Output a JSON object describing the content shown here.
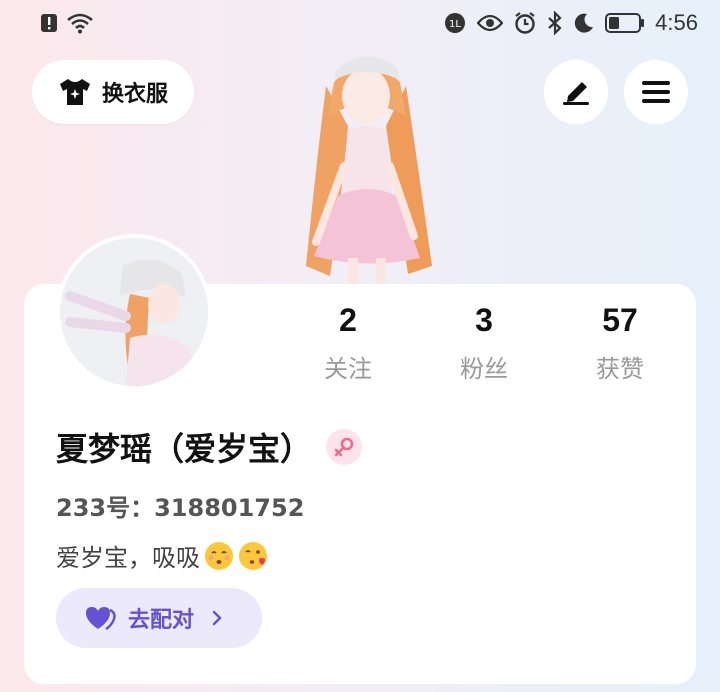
{
  "status_bar": {
    "time": "4:56",
    "left_icons": [
      "alert-icon",
      "wifi-icon"
    ],
    "right_icons": [
      "hd-icon",
      "eye-icon",
      "alarm-icon",
      "bluetooth-icon",
      "moon-icon",
      "battery-icon"
    ]
  },
  "top_actions": {
    "outfit_label": "换衣服",
    "edit_icon": "pen-icon",
    "menu_icon": "menu-icon"
  },
  "profile": {
    "name": "夏梦瑶（爱岁宝）",
    "gender": "female",
    "id_line": "233号：318801752",
    "bio": "爱岁宝，吸吸",
    "bio_emojis": [
      "kissing-emoji",
      "kissing-heart-emoji"
    ]
  },
  "stats": [
    {
      "value": "2",
      "label": "关注"
    },
    {
      "value": "3",
      "label": "粉丝"
    },
    {
      "value": "57",
      "label": "获赞"
    }
  ],
  "match_button": {
    "label": "去配对"
  },
  "colors": {
    "accent": "#6352d3",
    "match_bg": "#ece9fb",
    "gender_bg": "#fde4ea",
    "gender_icon": "#f06a8a"
  }
}
